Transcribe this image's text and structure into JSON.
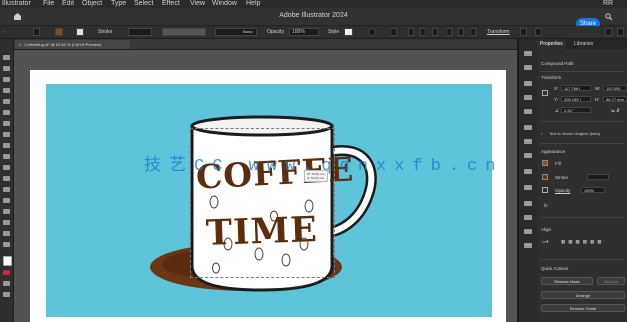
{
  "menubar": {
    "items": [
      "Illustrator",
      "File",
      "Edit",
      "Object",
      "Type",
      "Select",
      "Effect",
      "View",
      "Window",
      "Help"
    ],
    "right_text": "RR"
  },
  "window": {
    "title": "Adobe Illustrator 2024",
    "share_label": "Share"
  },
  "control_bar": {
    "stroke_label": "Stroke",
    "stroke_style": "Basic",
    "opacity_label": "Opacity",
    "opacity_value": "100%",
    "style_label": "Style",
    "transform_label": "Transform"
  },
  "document": {
    "tab_label": "CoffeeMug.ai* @ 63.83 % (CMYK/Preview)"
  },
  "artwork": {
    "mug_text_line1": "COFFEE",
    "mug_text_line2": "TIME",
    "selection_tooltip": [
      "W: 78.89 mm",
      "H: 53.00 mm"
    ],
    "watermark": "技艺CC www.qdnxxfb.cn"
  },
  "properties_panel": {
    "tabs": [
      "Properties",
      "Libraries"
    ],
    "selection_type": "Compound Path",
    "transform_header": "Transform",
    "x_label": "X:",
    "x_value": "117.766 I",
    "y_label": "Y:",
    "y_value": "205.189 I",
    "w_label": "W:",
    "w_value": "102.005",
    "h_label": "H:",
    "h_value": "56.77 mm",
    "angle_value": "2.53 °",
    "text_to_vector": "Text to Vector Graphic (beta)",
    "appearance_header": "Appearance",
    "fill_label": "Fill",
    "stroke_label": "Stroke",
    "opacity_label": "Opacity",
    "opacity_value": "100%",
    "fx_label": "fx",
    "align_header": "Align",
    "quick_actions_header": "Quick Actions",
    "release_mask": "Release Mask",
    "arrange_label": "Arrange",
    "recolor": "Recolor",
    "rotate_label": "Release Guide",
    "fill_color": "#8a4a1e",
    "stroke_color": "#6b3416"
  },
  "colors": {
    "accent": "#1473e6",
    "artwork_bg": "#5ec4d9",
    "coffee_brown": "#5c2e0e",
    "saucer_brown": "#6b3614"
  }
}
